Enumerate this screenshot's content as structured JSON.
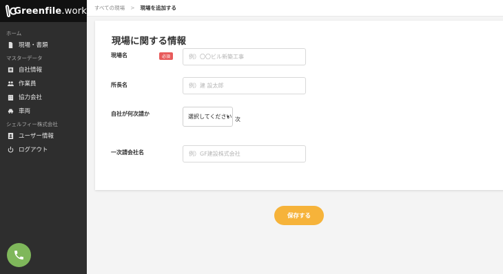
{
  "brand": {
    "name_bold": "Greenfile",
    "name_suffix": ".work"
  },
  "sidebar": {
    "sections": [
      {
        "label": "ホーム",
        "items": [
          {
            "label": "現場・書類",
            "icon": "document-icon"
          }
        ]
      },
      {
        "label": "マスターデータ",
        "items": [
          {
            "label": "自社情報",
            "icon": "id-card-icon"
          },
          {
            "label": "作業員",
            "icon": "users-icon"
          },
          {
            "label": "協力会社",
            "icon": "building-icon"
          },
          {
            "label": "車両",
            "icon": "car-icon"
          }
        ]
      },
      {
        "label": "シェルフィー株式会社",
        "items": [
          {
            "label": "ユーザー情報",
            "icon": "user-card-icon"
          },
          {
            "label": "ログアウト",
            "icon": "power-icon"
          }
        ]
      }
    ],
    "phone_icon": "phone-icon"
  },
  "breadcrumb": {
    "parent": "すべての現場",
    "separator": ">",
    "current": "現場を追加する"
  },
  "form": {
    "title": "現場に関する情報",
    "site_name": {
      "label": "現場名",
      "required_badge": "必須",
      "value": "",
      "placeholder": "例）〇〇ビル新築工事"
    },
    "manager": {
      "label": "所長名",
      "value": "",
      "placeholder": "例）建 設太郎"
    },
    "tier": {
      "label": "自社が何次請か",
      "selected": "選択してください",
      "suffix": "次"
    },
    "primary_contractor": {
      "label": "一次請会社名",
      "value": "",
      "placeholder": "例）GF建設株式会社"
    },
    "save_label": "保存する"
  },
  "colors": {
    "accent": "#f6b33a",
    "sidebar": "#2e2e2e",
    "required": "#e85b5b",
    "phone": "#7fb75b"
  }
}
